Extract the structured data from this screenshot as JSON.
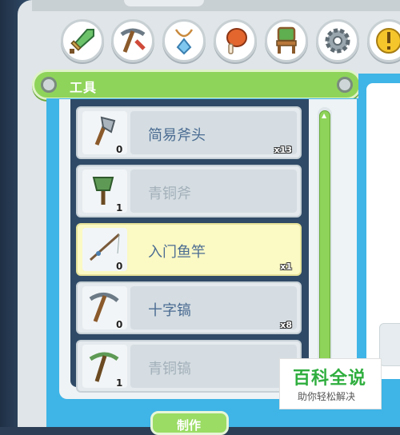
{
  "category_tabs": [
    {
      "icon": "sword-icon"
    },
    {
      "icon": "pickaxe-icon"
    },
    {
      "icon": "amulet-icon"
    },
    {
      "icon": "meat-icon"
    },
    {
      "icon": "chair-icon"
    },
    {
      "icon": "gear-icon"
    },
    {
      "icon": "exclamation-icon"
    }
  ],
  "header": {
    "title": "工具"
  },
  "items": [
    {
      "name": "简易斧头",
      "owned": "0",
      "quantity": "x13",
      "icon": "axe-icon",
      "state": "available"
    },
    {
      "name": "青铜斧",
      "owned": "1",
      "quantity": "",
      "icon": "bronze-axe-icon",
      "state": "locked"
    },
    {
      "name": "入门鱼竿",
      "owned": "0",
      "quantity": "x1",
      "icon": "fishing-rod-icon",
      "state": "selected"
    },
    {
      "name": "十字镐",
      "owned": "0",
      "quantity": "x8",
      "icon": "pickaxe-icon",
      "state": "available"
    },
    {
      "name": "青铜镐",
      "owned": "1",
      "quantity": "",
      "icon": "bronze-pickaxe-icon",
      "state": "locked"
    }
  ],
  "make_button": {
    "label": "制作"
  },
  "watermark": {
    "title": "百科全说",
    "subtitle": "助你轻松解决"
  },
  "colors": {
    "accent_green": "#8fd45a",
    "panel_blue": "#3fb4e6",
    "selected_row": "#fbf9c4",
    "item_text": "#4b6c92"
  }
}
